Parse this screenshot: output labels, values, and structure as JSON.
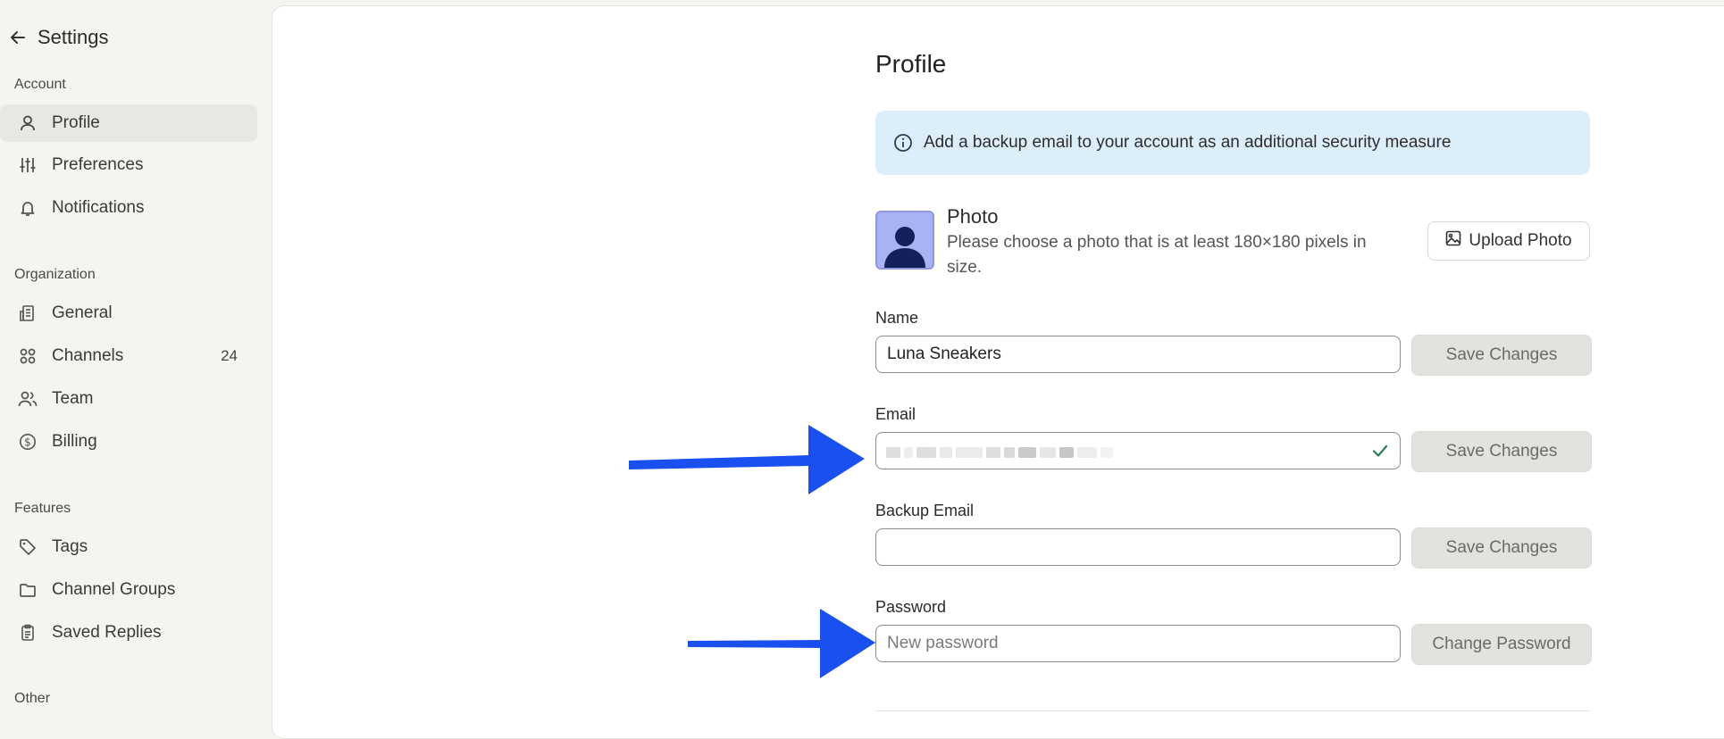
{
  "sidebar": {
    "title": "Settings",
    "sections": {
      "account": "Account",
      "organization": "Organization",
      "features": "Features",
      "other": "Other"
    },
    "items": {
      "profile": "Profile",
      "preferences": "Preferences",
      "notifications": "Notifications",
      "general": "General",
      "channels": "Channels",
      "channels_count": "24",
      "team": "Team",
      "billing": "Billing",
      "tags": "Tags",
      "channel_groups": "Channel Groups",
      "saved_replies": "Saved Replies"
    }
  },
  "main": {
    "title": "Profile",
    "banner": "Add a backup email to your account as an additional security measure",
    "photo": {
      "title": "Photo",
      "description": "Please choose a photo that is at least 180×180 pixels in size.",
      "upload_label": "Upload Photo"
    },
    "name": {
      "label": "Name",
      "value": "Luna Sneakers",
      "button": "Save Changes"
    },
    "email": {
      "label": "Email",
      "value": "",
      "button": "Save Changes"
    },
    "backup_email": {
      "label": "Backup Email",
      "value": "",
      "button": "Save Changes"
    },
    "password": {
      "label": "Password",
      "placeholder": "New password",
      "button": "Change Password"
    }
  },
  "colors": {
    "accent_arrow": "#1a4ff0",
    "banner_bg": "#ddeefb",
    "check": "#2e7d4f",
    "avatar_bg": "#a9b2f2"
  }
}
